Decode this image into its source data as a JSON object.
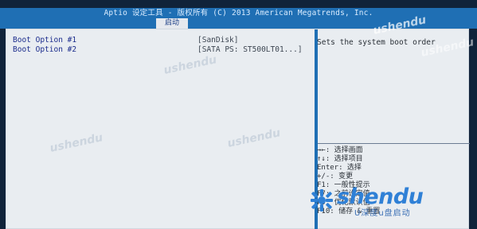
{
  "header": {
    "title": "Aptio 设定工具 - 版权所有 (C) 2013 American Megatrends, Inc.",
    "active_tab": "启动"
  },
  "boot_options": [
    {
      "label": "Boot Option #1",
      "value": "[SanDisk]"
    },
    {
      "label": "Boot Option #2",
      "value": "[SATA  PS: ST500LT01...]"
    }
  ],
  "help": {
    "description": "Sets the system boot order",
    "keys": [
      "→←: 选择画面",
      "↑↓: 选择项目",
      "Enter: 选择",
      "+/-: 变更",
      "F1: 一般性提示",
      "F7: 之前设定值",
      "F9: 优化默认值",
      "F10: 储存 & 重置"
    ]
  },
  "watermark": {
    "small": "ushendu",
    "brand": "shendu",
    "brand_tag": "U深度u盘启动"
  },
  "colors": {
    "title_bar": "#1f6fb4",
    "panel": "#e9edf1",
    "option_label": "#1b2c8c",
    "brand": "#2f80d6"
  }
}
